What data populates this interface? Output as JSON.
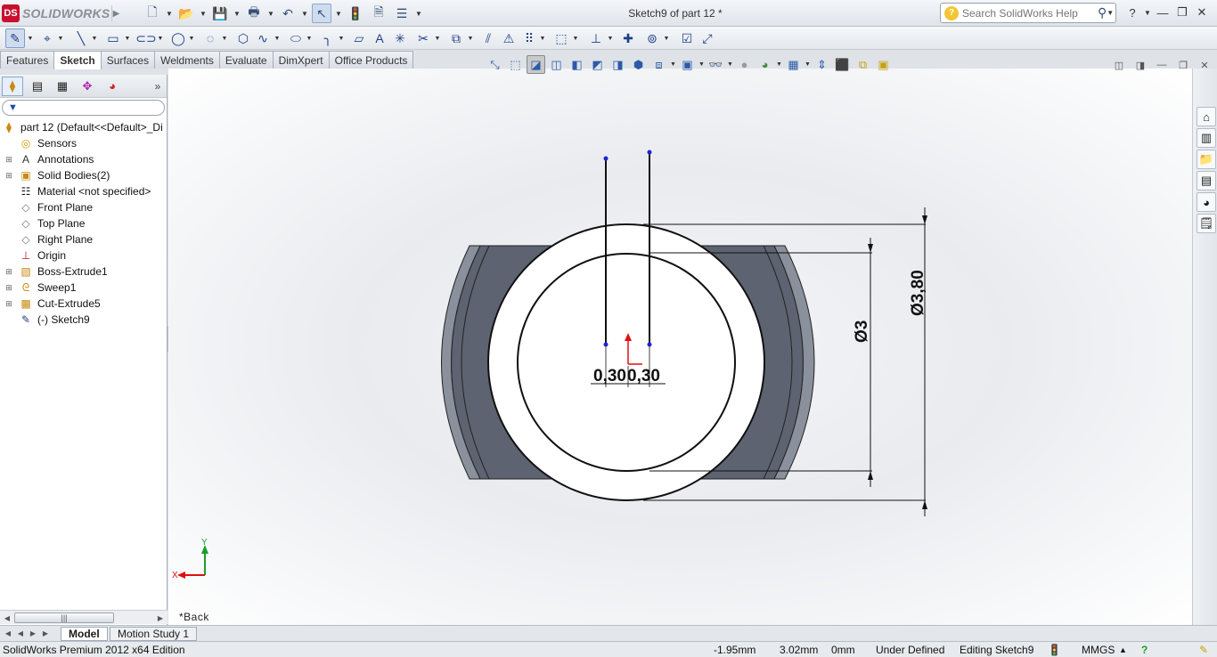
{
  "app": {
    "logo_mark": "DS",
    "logo_text": "SOLIDWORKS",
    "document_title": "Sketch9 of part 12 *",
    "search_placeholder": "Search SolidWorks Help"
  },
  "quick_access": [
    "new-icon",
    "open-icon",
    "save-icon",
    "print-icon",
    "undo-icon",
    "select-icon",
    "rebuild-icon",
    "file-properties-icon",
    "options-icon"
  ],
  "command_tabs": [
    {
      "label": "Features",
      "active": false
    },
    {
      "label": "Sketch",
      "active": true
    },
    {
      "label": "Surfaces",
      "active": false
    },
    {
      "label": "Weldments",
      "active": false
    },
    {
      "label": "Evaluate",
      "active": false
    },
    {
      "label": "DimXpert",
      "active": false
    },
    {
      "label": "Office Products",
      "active": false
    }
  ],
  "feature_tree": {
    "root": "part 12  (Default<<Default>_Di",
    "items": [
      {
        "label": "Sensors",
        "expandable": false,
        "icon": "sensor-icon"
      },
      {
        "label": "Annotations",
        "expandable": true,
        "icon": "annotation-icon"
      },
      {
        "label": "Solid Bodies(2)",
        "expandable": true,
        "icon": "solid-bodies-icon"
      },
      {
        "label": "Material <not specified>",
        "expandable": false,
        "icon": "material-icon"
      },
      {
        "label": "Front Plane",
        "expandable": false,
        "icon": "plane-icon"
      },
      {
        "label": "Top Plane",
        "expandable": false,
        "icon": "plane-icon"
      },
      {
        "label": "Right Plane",
        "expandable": false,
        "icon": "plane-icon"
      },
      {
        "label": "Origin",
        "expandable": false,
        "icon": "origin-icon"
      },
      {
        "label": "Boss-Extrude1",
        "expandable": true,
        "icon": "extrude-icon"
      },
      {
        "label": "Sweep1",
        "expandable": true,
        "icon": "sweep-icon"
      },
      {
        "label": "Cut-Extrude5",
        "expandable": true,
        "icon": "cut-extrude-icon"
      },
      {
        "label": "(-) Sketch9",
        "expandable": false,
        "icon": "sketch-icon"
      }
    ]
  },
  "graphics": {
    "dimensions": {
      "outer_diameter": "Ø3,80",
      "inner_diameter": "Ø3",
      "offset_left": "0,30",
      "offset_right": "0,30"
    },
    "triad": {
      "x_label": "X",
      "y_label": "Y"
    },
    "view_label": "*Back"
  },
  "bottom_tabs": [
    {
      "label": "Model",
      "active": true
    },
    {
      "label": "Motion Study 1",
      "active": false
    }
  ],
  "status": {
    "edition": "SolidWorks Premium 2012 x64 Edition",
    "x": "-1.95mm",
    "y": "3.02mm",
    "z": "0mm",
    "state": "Under Defined",
    "editing": "Editing Sketch9",
    "units": "MMGS"
  },
  "colors": {
    "accent": "#c8102e",
    "sketch_point": "#1a24d6",
    "origin": "#e01010",
    "body_dark": "#5d6370"
  }
}
